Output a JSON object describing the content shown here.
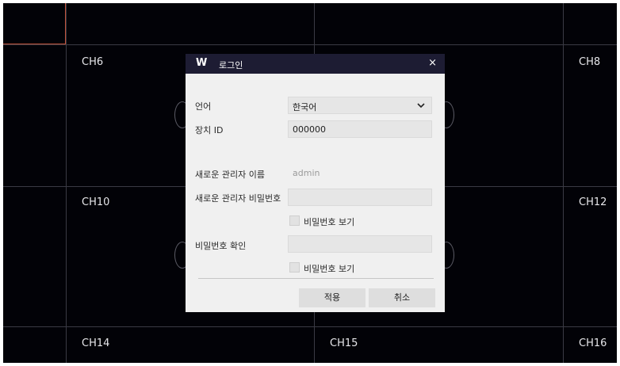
{
  "channels": {
    "ch6": "CH6",
    "ch8": "CH8",
    "ch10": "CH10",
    "ch12": "CH12",
    "ch14": "CH14",
    "ch15": "CH15",
    "ch16": "CH16"
  },
  "dialog": {
    "logo": "W",
    "title": "로그인",
    "close": "×",
    "language": {
      "label": "언어",
      "value": "한국어"
    },
    "device_id": {
      "label": "장치 ID",
      "value": "000000"
    },
    "new_admin_name": {
      "label": "새로운 관리자 이름",
      "value": "admin"
    },
    "new_admin_password": {
      "label": "새로운 관리자 비밀번호",
      "value": "",
      "show_label": "비밀번호 보기",
      "show_checked": false
    },
    "confirm_password": {
      "label": "비밀번호 확인",
      "value": "",
      "show_label": "비밀번호 보기",
      "show_checked": false
    },
    "apply_button": "적용",
    "cancel_button": "취소"
  },
  "colors": {
    "background": "#020207",
    "grid_line": "#3a3a44",
    "selected_border": "#c0523a",
    "titlebar": "#1d1c33",
    "dialog_bg": "#f0f0f0"
  }
}
